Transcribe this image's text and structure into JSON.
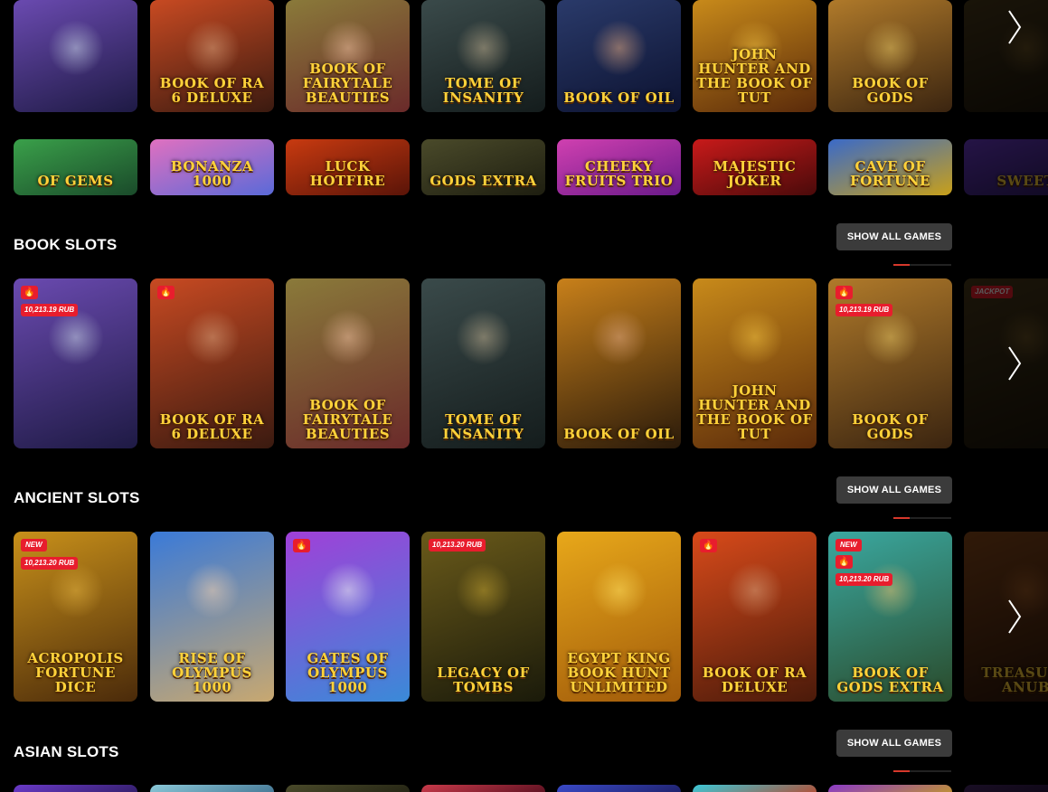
{
  "colors": {
    "background": "#000000",
    "button": "#3b3b3b",
    "accent_red": "#e81d2d",
    "pager_active": "#d6382b"
  },
  "rows": {
    "top_row_1": {
      "tiles": [
        {
          "title": "",
          "bg": [
            "#6a4ab0",
            "#1e1a44"
          ],
          "figure": "#c9d6e8"
        },
        {
          "title": "Book of Ra 6 deluxe",
          "bg": [
            "#c84a22",
            "#3a1a10"
          ],
          "figure": "#d7a07a"
        },
        {
          "title": "Book of Fairytale Beauties",
          "bg": [
            "#8a7a3a",
            "#6a2a2a"
          ],
          "figure": "#f0c0a0"
        },
        {
          "title": "Tome of Insanity",
          "bg": [
            "#3a4a4a",
            "#141c1c"
          ],
          "figure": "#c0b090"
        },
        {
          "title": "Book of Oil",
          "bg": [
            "#2a3a6a",
            "#0c1230"
          ],
          "figure": "#e0a880"
        },
        {
          "title": "John Hunter and the Book of Tut",
          "bg": [
            "#c88a1a",
            "#5a2a0a"
          ],
          "figure": "#f0c040"
        },
        {
          "title": "Book of Gods",
          "bg": [
            "#b07a2a",
            "#3a2410"
          ],
          "figure": "#e0c060"
        },
        {
          "title": "",
          "bg": [
            "#4a3a1a",
            "#1a140a"
          ],
          "figure": "#8a6a30"
        }
      ]
    },
    "top_row_2": {
      "tiles": [
        {
          "title": "Of Gems",
          "bg": [
            "#3aa04a",
            "#1a4a2a"
          ]
        },
        {
          "title": "Bonanza 1000",
          "bg": [
            "#e070c0",
            "#5a6ad8"
          ]
        },
        {
          "title": "Luck Hotfire",
          "bg": [
            "#c83a10",
            "#5a1408"
          ]
        },
        {
          "title": "Gods Extra",
          "bg": [
            "#4a4a2a",
            "#1e1e10"
          ]
        },
        {
          "title": "Cheeky Fruits Trio",
          "bg": [
            "#d040b0",
            "#6a1a8a"
          ]
        },
        {
          "title": "Majestic Joker",
          "bg": [
            "#c81a1a",
            "#4a0a0a"
          ]
        },
        {
          "title": "Cave of Fortune",
          "bg": [
            "#3a6ac8",
            "#c8a01a"
          ]
        },
        {
          "title": "Sweet",
          "bg": [
            "#6a3ac8",
            "#2a1a5a"
          ]
        }
      ]
    }
  },
  "sections": [
    {
      "title": "BOOK SLOTS",
      "show_all_label": "SHOW ALL GAMES",
      "tiles": [
        {
          "title": "",
          "bg": [
            "#6a4ab0",
            "#1e1a44"
          ],
          "figure": "#c9d6e8",
          "hot": true,
          "jackpot": "10,213.19 RUB"
        },
        {
          "title": "Book of Ra 6 deluxe",
          "bg": [
            "#c84a22",
            "#3a1a10"
          ],
          "figure": "#d7a07a",
          "hot": true
        },
        {
          "title": "Book of Fairytale Beauties",
          "bg": [
            "#8a7a3a",
            "#6a2a2a"
          ],
          "figure": "#f0c0a0"
        },
        {
          "title": "Tome of Insanity",
          "bg": [
            "#3a4a4a",
            "#141c1c"
          ],
          "figure": "#c0b090"
        },
        {
          "title": "Book of Oil",
          "bg": [
            "#c8801a",
            "#2a1a0a"
          ],
          "figure": "#e0a880"
        },
        {
          "title": "John Hunter and the Book of Tut",
          "bg": [
            "#c88a1a",
            "#5a2a0a"
          ],
          "figure": "#f0c040"
        },
        {
          "title": "Book of Gods",
          "bg": [
            "#b07a2a",
            "#3a2410"
          ],
          "figure": "#e0c060",
          "hot": true,
          "jackpot": "10,213.19 RUB"
        },
        {
          "title": "",
          "bg": [
            "#4a3a1a",
            "#1a140a"
          ],
          "figure": "#8a6a30",
          "jackpot_solo": "JACKPOT"
        }
      ]
    },
    {
      "title": "ANCIENT SLOTS",
      "show_all_label": "SHOW ALL GAMES",
      "tiles": [
        {
          "title": "Acropolis Fortune Dice",
          "bg": [
            "#c8901a",
            "#4a2a0a"
          ],
          "figure": "#e0b040",
          "new": "NEW",
          "jackpot": "10,213.20 RUB"
        },
        {
          "title": "Rise of Olympus 1000",
          "bg": [
            "#3a7ad8",
            "#c8a870"
          ],
          "figure": "#f0d0b0"
        },
        {
          "title": "Gates of Olympus 1000",
          "bg": [
            "#a040d8",
            "#3a8ad8"
          ],
          "figure": "#f0f0f0",
          "hot": true
        },
        {
          "title": "Legacy of Tombs",
          "bg": [
            "#6a5a1a",
            "#1a1a0a"
          ],
          "figure": "#c0a030",
          "jackpot_solo": "10,213.20 RUB"
        },
        {
          "title": "Egypt King Book Hunt unlimited",
          "bg": [
            "#e8a81a",
            "#a05a0a"
          ],
          "figure": "#ffe060"
        },
        {
          "title": "Book of Ra deluxe",
          "bg": [
            "#d84a1a",
            "#4a1a0a"
          ],
          "figure": "#d7a07a",
          "hot": true
        },
        {
          "title": "Book of Gods Extra",
          "bg": [
            "#3aa8a0",
            "#2a4a2a"
          ],
          "figure": "#e0c070",
          "new": "NEW",
          "hot": true,
          "jackpot": "10,213.20 RUB"
        },
        {
          "title": "Treasure Anub",
          "bg": [
            "#8a4a1a",
            "#2a140a"
          ],
          "figure": "#c07030"
        }
      ]
    },
    {
      "title": "ASIAN SLOTS",
      "show_all_label": "SHOW ALL GAMES",
      "tiles": [
        {
          "bg": [
            "#6a3ac8",
            "#2a1a5a"
          ]
        },
        {
          "bg": [
            "#8ac8d8",
            "#3a6a8a"
          ]
        },
        {
          "bg": [
            "#4a4a2a",
            "#1e1e10"
          ]
        },
        {
          "bg": [
            "#c83a4a",
            "#4a0a1a"
          ]
        },
        {
          "bg": [
            "#3a4ac8",
            "#1a1a5a"
          ]
        },
        {
          "bg": [
            "#3ac8d8",
            "#c83a1a"
          ]
        },
        {
          "bg": [
            "#8a3ac8",
            "#c8a01a"
          ]
        },
        {
          "bg": [
            "#4a2a6a",
            "#1a0a2a"
          ]
        }
      ]
    }
  ],
  "icons": {
    "next": "chevron-right-icon",
    "hot": "flame-icon"
  },
  "hot_glyph": "🔥"
}
